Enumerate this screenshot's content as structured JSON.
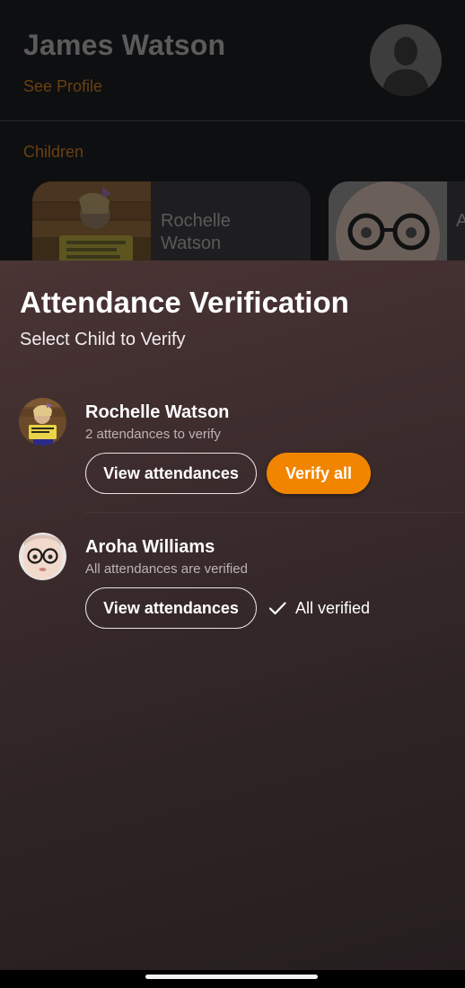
{
  "background": {
    "profile_name": "James Watson",
    "see_profile_link": "See Profile",
    "avatar_icon": "person-silhouette-icon",
    "children_label": "Children",
    "children_cards": [
      {
        "name": "Rochelle Watson"
      },
      {
        "name": "Aroha Williams"
      }
    ]
  },
  "sheet": {
    "title": "Attendance Verification",
    "subtitle": "Select Child to Verify",
    "children": [
      {
        "name": "Rochelle Watson",
        "status": "2 attendances to verify",
        "view_button": "View attendances",
        "verify_button": "Verify all"
      },
      {
        "name": "Aroha Williams",
        "status": "All attendances are verified",
        "view_button": "View attendances",
        "verified_label": "All verified",
        "verified_icon": "checkmark-icon"
      }
    ]
  },
  "colors": {
    "accent": "#f28500",
    "sheet_top": "#4a3434",
    "sheet_bottom": "#251e1f",
    "muted_link": "#6a4010"
  }
}
